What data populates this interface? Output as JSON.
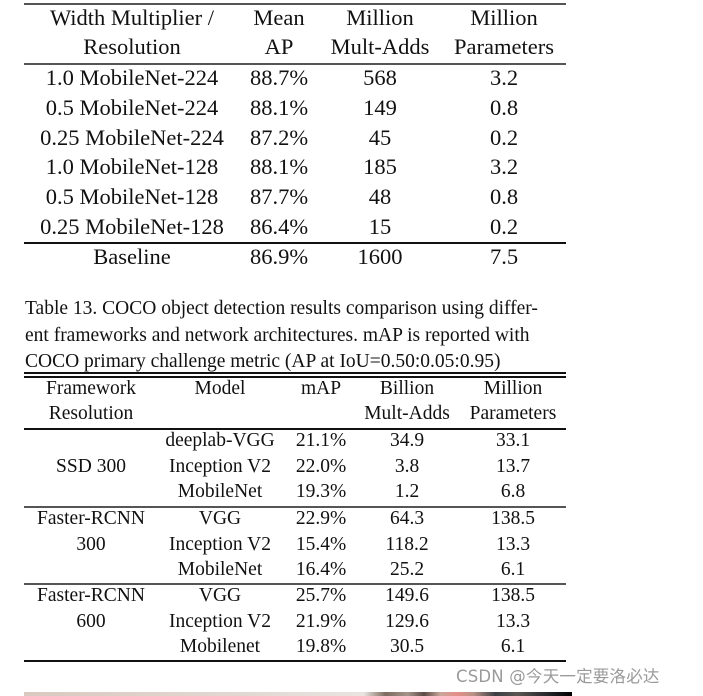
{
  "table12": {
    "headers": [
      [
        "Width Multiplier /",
        "Resolution"
      ],
      [
        "Mean",
        "AP"
      ],
      [
        "Million",
        "Mult-Adds"
      ],
      [
        "Million",
        "Parameters"
      ]
    ],
    "rows": [
      [
        "1.0 MobileNet-224",
        "88.7%",
        "568",
        "3.2"
      ],
      [
        "0.5 MobileNet-224",
        "88.1%",
        "149",
        "0.8"
      ],
      [
        "0.25 MobileNet-224",
        "87.2%",
        "45",
        "0.2"
      ],
      [
        "1.0 MobileNet-128",
        "88.1%",
        "185",
        "3.2"
      ],
      [
        "0.5 MobileNet-128",
        "87.7%",
        "48",
        "0.8"
      ],
      [
        "0.25 MobileNet-128",
        "86.4%",
        "15",
        "0.2"
      ]
    ],
    "baseline": [
      "Baseline",
      "86.9%",
      "1600",
      "7.5"
    ]
  },
  "table13": {
    "caption_lines": [
      "Table 13. COCO object detection results comparison using differ-",
      "ent frameworks and network architectures.  mAP is reported with",
      "COCO primary challenge metric (AP at IoU=0.50:0.05:0.95)"
    ],
    "headers": [
      [
        "Framework",
        "Resolution"
      ],
      [
        "Model",
        ""
      ],
      [
        "mAP",
        ""
      ],
      [
        "Billion",
        "Mult-Adds"
      ],
      [
        "Million",
        "Parameters"
      ]
    ],
    "groups": [
      {
        "framework": [
          "",
          "SSD 300",
          ""
        ],
        "rows": [
          [
            "deeplab-VGG",
            "21.1%",
            "34.9",
            "33.1"
          ],
          [
            "Inception V2",
            "22.0%",
            "3.8",
            "13.7"
          ],
          [
            "MobileNet",
            "19.3%",
            "1.2",
            "6.8"
          ]
        ]
      },
      {
        "framework": [
          "Faster-RCNN",
          "300",
          ""
        ],
        "rows": [
          [
            "VGG",
            "22.9%",
            "64.3",
            "138.5"
          ],
          [
            "Inception V2",
            "15.4%",
            "118.2",
            "13.3"
          ],
          [
            "MobileNet",
            "16.4%",
            "25.2",
            "6.1"
          ]
        ]
      },
      {
        "framework": [
          "Faster-RCNN",
          "600",
          ""
        ],
        "rows": [
          [
            "VGG",
            "25.7%",
            "149.6",
            "138.5"
          ],
          [
            "Inception V2",
            "21.9%",
            "129.6",
            "13.3"
          ],
          [
            "Mobilenet",
            "19.8%",
            "30.5",
            "6.1"
          ]
        ]
      }
    ]
  },
  "watermark": "CSDN @今天一定要洛必达"
}
